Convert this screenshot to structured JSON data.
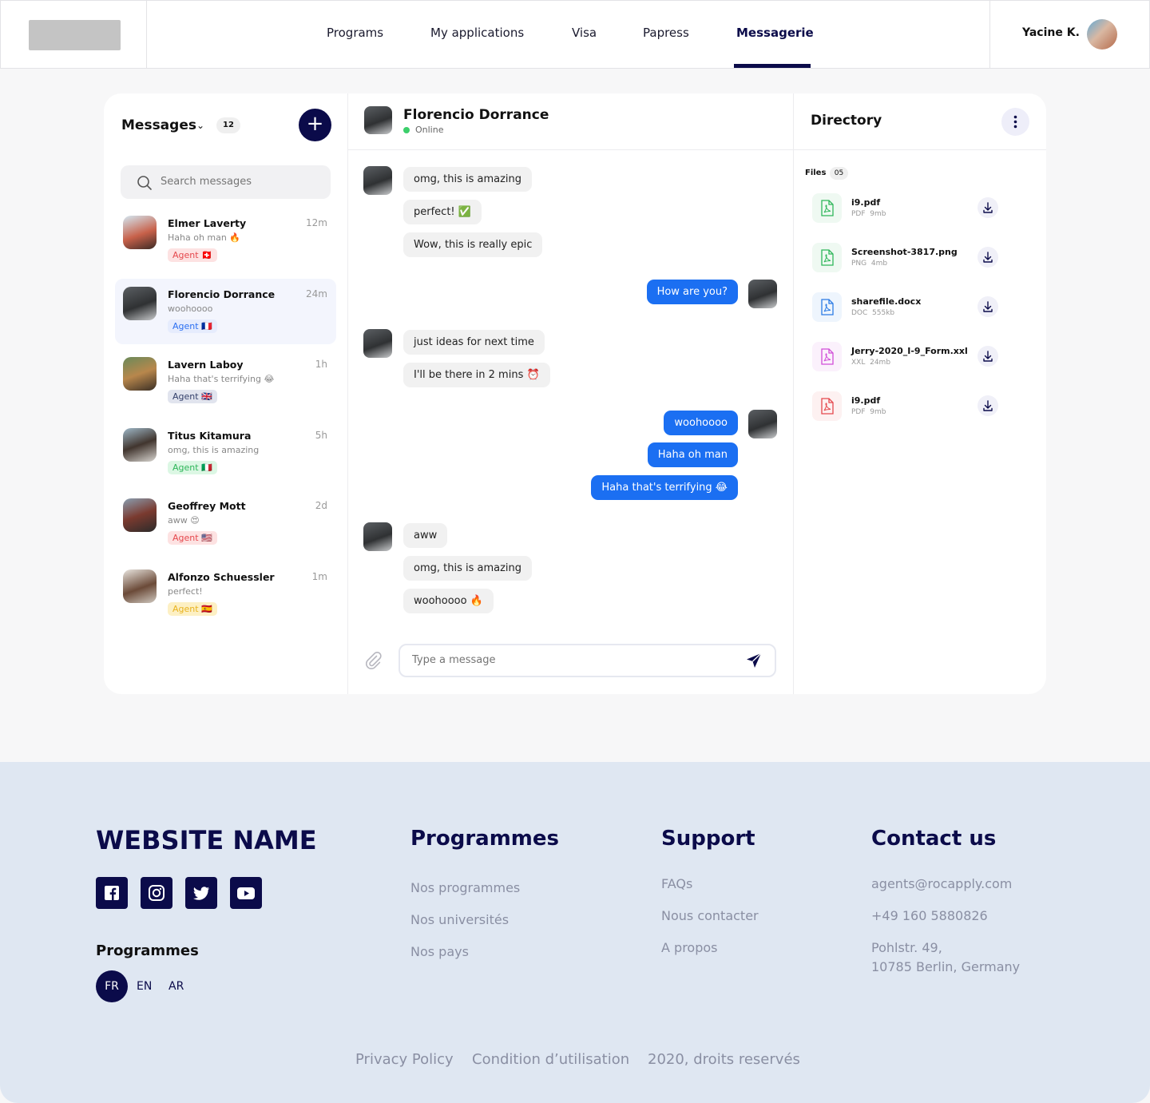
{
  "header": {
    "nav": [
      "Programs",
      "My applications",
      "Visa",
      "Papress",
      "Messagerie"
    ],
    "active_nav": "Messagerie",
    "user_name": "Yacine K."
  },
  "messages_panel": {
    "title": "Messages",
    "count": "12",
    "search_placeholder": "Search messages",
    "conversations": [
      {
        "name": "Elmer Laverty",
        "time": "12m",
        "preview": "Haha oh man 🔥",
        "tag": "Agent 🇨🇭"
      },
      {
        "name": "Florencio Dorrance",
        "time": "24m",
        "preview": "woohoooo",
        "tag": "Agent 🇫🇷"
      },
      {
        "name": "Lavern Laboy",
        "time": "1h",
        "preview": "Haha that's terrifying 😂",
        "tag": "Agent 🇬🇧"
      },
      {
        "name": "Titus Kitamura",
        "time": "5h",
        "preview": "omg, this is amazing",
        "tag": "Agent 🇮🇹"
      },
      {
        "name": "Geoffrey Mott",
        "time": "2d",
        "preview": "aww 😍",
        "tag": "Agent 🇺🇸"
      },
      {
        "name": "Alfonzo Schuessler",
        "time": "1m",
        "preview": "perfect!",
        "tag": "Agent 🇪🇸"
      }
    ]
  },
  "chat": {
    "contact_name": "Florencio Dorrance",
    "status": "Online",
    "messages": [
      {
        "dir": "in",
        "text": "omg, this is amazing"
      },
      {
        "dir": "in",
        "text": "perfect! ✅"
      },
      {
        "dir": "in",
        "text": "Wow, this is really epic"
      },
      {
        "dir": "out",
        "text": "How are you?"
      },
      {
        "dir": "in",
        "text": "just ideas for next time"
      },
      {
        "dir": "in",
        "text": "I'll be there in 2 mins ⏰"
      },
      {
        "dir": "out",
        "text": "woohoooo"
      },
      {
        "dir": "out",
        "text": "Haha oh man"
      },
      {
        "dir": "out",
        "text": "Haha that's terrifying 😂"
      },
      {
        "dir": "in",
        "text": "aww"
      },
      {
        "dir": "in",
        "text": "omg, this is amazing"
      },
      {
        "dir": "in",
        "text": "woohoooo 🔥"
      }
    ],
    "compose_placeholder": "Type a message"
  },
  "directory": {
    "title": "Directory",
    "files_label": "Files",
    "files_count": "05",
    "files": [
      {
        "name": "i9.pdf",
        "type": "PDF",
        "size": "9mb",
        "color": "#2fb65a"
      },
      {
        "name": "Screenshot-3817.png",
        "type": "PNG",
        "size": "4mb",
        "color": "#2fb65a"
      },
      {
        "name": "sharefile.docx",
        "type": "DOC",
        "size": "555kb",
        "color": "#2b7be5"
      },
      {
        "name": "Jerry-2020_I-9_Form.xxl",
        "type": "XXL",
        "size": "24mb",
        "color": "#d14ed8"
      },
      {
        "name": "i9.pdf",
        "type": "PDF",
        "size": "9mb",
        "color": "#e5484d"
      }
    ]
  },
  "footer": {
    "site_name": "WEBSITE NAME",
    "language_title": "Programmes",
    "languages": [
      "FR",
      "EN",
      "AR"
    ],
    "programmes": {
      "title": "Programmes",
      "links": [
        "Nos programmes",
        "Nos universités",
        "Nos pays"
      ]
    },
    "support": {
      "title": "Support",
      "links": [
        "FAQs",
        "Nous contacter",
        "A propos"
      ]
    },
    "contact": {
      "title": "Contact us",
      "email": "agents@rocapply.com",
      "phone": "+49 160 5880826",
      "address_1": "Pohlstr. 49,",
      "address_2": "10785 Berlin, Germany"
    },
    "bottom_links": [
      "Privacy Policy",
      "Condition d’utilisation",
      "2020, droits reservés"
    ]
  },
  "colors": {
    "brand": "#0b0b4a",
    "outgoing_bubble": "#1b6ff2",
    "online": "#3ccf6b"
  }
}
